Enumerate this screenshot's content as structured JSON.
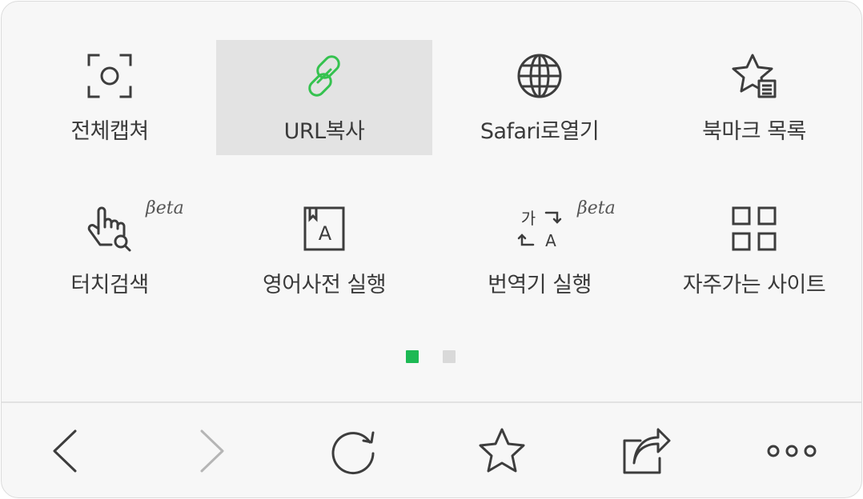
{
  "menu": {
    "items": [
      {
        "label": "전체캡쳐",
        "icon": "capture-icon",
        "selected": false,
        "beta": ""
      },
      {
        "label": "URL복사",
        "icon": "link-icon",
        "selected": true,
        "beta": ""
      },
      {
        "label": "Safari로열기",
        "icon": "globe-icon",
        "selected": false,
        "beta": ""
      },
      {
        "label": "북마크 목록",
        "icon": "bookmark-list-icon",
        "selected": false,
        "beta": ""
      },
      {
        "label": "터치검색",
        "icon": "touch-search-icon",
        "selected": false,
        "beta": "βeta"
      },
      {
        "label": "영어사전 실행",
        "icon": "dictionary-icon",
        "selected": false,
        "beta": ""
      },
      {
        "label": "번역기 실행",
        "icon": "translate-icon",
        "selected": false,
        "beta": "βeta"
      },
      {
        "label": "자주가는 사이트",
        "icon": "grid-icon",
        "selected": false,
        "beta": ""
      }
    ],
    "translate_icon_text": {
      "ko": "가",
      "en": "A"
    },
    "dictionary_icon_text": "A"
  },
  "pager": {
    "total": 2,
    "current": 1
  },
  "toolbar": {
    "buttons": [
      "back-icon",
      "forward-icon",
      "reload-icon",
      "star-icon",
      "share-icon",
      "more-icon"
    ],
    "forward_enabled": false
  },
  "colors": {
    "accent": "#1db954",
    "link_icon": "#35c24f",
    "icon": "#3d3d3d",
    "disabled": "#b5b5b5",
    "selected_bg": "#e3e3e3",
    "dot_inactive": "#d9d9d9"
  }
}
